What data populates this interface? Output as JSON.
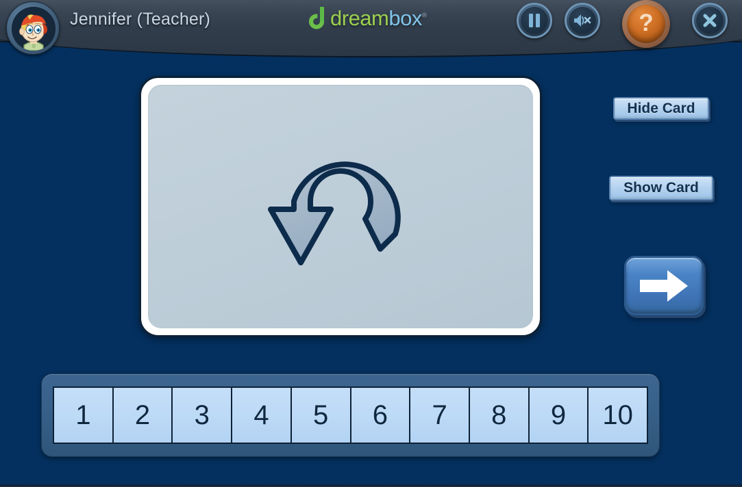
{
  "header": {
    "user_name": "Jennifer (Teacher)",
    "avatar_name": "student-avatar",
    "logo": {
      "mark": "dreambox-d-mark",
      "text_primary": "dream",
      "text_secondary": "box",
      "trademark": "®"
    },
    "buttons": [
      {
        "name": "pause-button",
        "icon": "pause-icon",
        "label": "Pause"
      },
      {
        "name": "mute-button",
        "icon": "speaker-mute-icon",
        "label": "Mute"
      },
      {
        "name": "help-button",
        "icon": "question-mark-icon",
        "label": "?"
      },
      {
        "name": "close-button",
        "icon": "close-x-icon",
        "label": "Close"
      }
    ]
  },
  "card": {
    "name": "lesson-card",
    "icon": "flip-card-u-turn-arrow-icon",
    "state": "face-down",
    "colors": {
      "face": "#bdcdd8",
      "border": "#ffffff",
      "outline": "#0d2136",
      "arrow_fill": "#9fb4c8",
      "arrow_stroke": "#0d2b4a"
    }
  },
  "controls": {
    "hide_card_label": "Hide Card",
    "show_card_label": "Show Card",
    "next_icon": "right-arrow-icon",
    "next_label": "Next"
  },
  "number_track": {
    "name": "number-track-1-to-10",
    "cells": [
      "1",
      "2",
      "3",
      "4",
      "5",
      "6",
      "7",
      "8",
      "9",
      "10"
    ]
  },
  "colors": {
    "background": "#04305f",
    "header": "#344050",
    "accent_blue": "#4a84c6",
    "accent_orange": "#cf6f24",
    "logo_green": "#9ccf4e",
    "logo_blue": "#7fc4e8",
    "cell_fill": "#bcd9f6",
    "track_fill": "#376089"
  }
}
